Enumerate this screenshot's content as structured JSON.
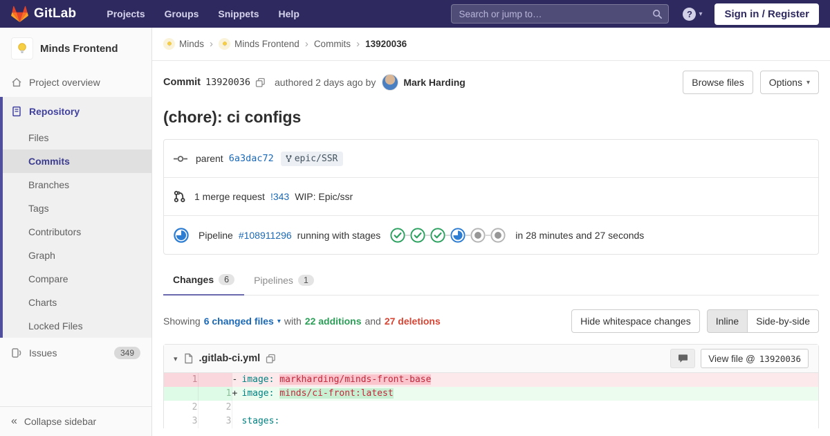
{
  "colors": {
    "navbar_bg": "#2e2a5f",
    "sidebar_accent": "#41419f",
    "link_blue": "#1b69b6",
    "additions_green": "#2b9e57",
    "deletions_red": "#d64433",
    "success_green": "#2da160",
    "running_blue": "#2d7dd2",
    "removed_line_bg": "#fbe9eb",
    "added_line_bg": "#ecfdf0"
  },
  "icons": {
    "question_mark": "?",
    "chevron_down": "▾",
    "breadcrumb_separator": "›",
    "collapse_chevrons": "«"
  },
  "navbar": {
    "logo_text": "GitLab",
    "menu": [
      "Projects",
      "Groups",
      "Snippets",
      "Help"
    ],
    "search_placeholder": "Search or jump to…",
    "sign_in_label": "Sign in / Register"
  },
  "sidebar": {
    "project_name": "Minds Frontend",
    "project_avatar": "lightbulb",
    "overview_label": "Project overview",
    "repository_label": "Repository",
    "repository_items": [
      "Files",
      "Commits",
      "Branches",
      "Tags",
      "Contributors",
      "Graph",
      "Compare",
      "Charts",
      "Locked Files"
    ],
    "active_repository_item": "Commits",
    "issues_label": "Issues",
    "issues_count": "349",
    "collapse_label": "Collapse sidebar"
  },
  "breadcrumb": {
    "items": [
      "Minds",
      "Minds Frontend",
      "Commits",
      "13920036"
    ]
  },
  "commit_header": {
    "commit_label": "Commit",
    "sha": "13920036",
    "authored_text": "authored 2 days ago by",
    "author_name": "Mark Harding",
    "browse_files_label": "Browse files",
    "options_label": "Options"
  },
  "commit": {
    "title": "(chore): ci configs",
    "parent_label": "parent",
    "parent_sha": "6a3dac72",
    "ref_badge": "epic/SSR",
    "merge_request_text": "1 merge request",
    "merge_request_id": "!343",
    "merge_request_title": "WIP: Epic/ssr",
    "pipeline_label": "Pipeline",
    "pipeline_id": "#108911296",
    "pipeline_status_text": "running with stages",
    "pipeline_stages": [
      "success",
      "success",
      "success",
      "running",
      "created",
      "created"
    ],
    "pipeline_duration": "in 28 minutes and 27 seconds"
  },
  "tabs": {
    "changes_label": "Changes",
    "changes_count": "6",
    "pipelines_label": "Pipelines",
    "pipelines_count": "1"
  },
  "diff_bar": {
    "showing": "Showing",
    "changed_files": "6 changed files",
    "with": "with",
    "additions": "22 additions",
    "and": "and",
    "deletions": "27 deletions",
    "hide_whitespace_label": "Hide whitespace changes",
    "inline_label": "Inline",
    "side_by_side_label": "Side-by-side"
  },
  "file_diff": {
    "filename": ".gitlab-ci.yml",
    "view_file_prefix": "View file @",
    "view_file_sha": "13920036",
    "lines": [
      {
        "old_num": "1",
        "new_num": "",
        "type": "removed",
        "sign": "-",
        "key": "image: ",
        "value": "markharding/minds-front-base"
      },
      {
        "old_num": "",
        "new_num": "1",
        "type": "added",
        "sign": "+",
        "key": "image: ",
        "value": "minds/ci-front:latest"
      },
      {
        "old_num": "2",
        "new_num": "2",
        "type": "context",
        "sign": "",
        "key": "",
        "value": ""
      },
      {
        "old_num": "3",
        "new_num": "3",
        "type": "context",
        "sign": "",
        "key": "stages:",
        "value": ""
      }
    ]
  }
}
